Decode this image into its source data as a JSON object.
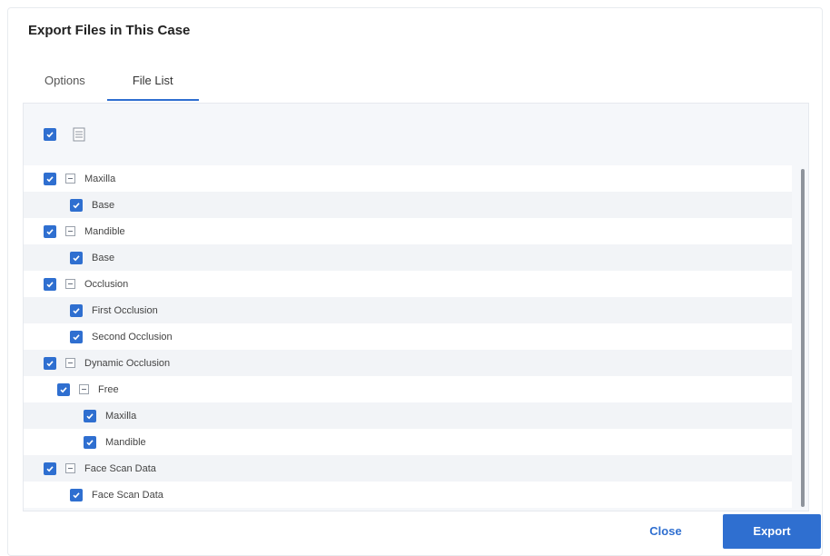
{
  "dialog": {
    "title": "Export Files in This Case",
    "tabs": [
      {
        "label": "Options",
        "active": false
      },
      {
        "label": "File List",
        "active": true
      }
    ],
    "select_all_checked": true,
    "tree": [
      {
        "label": "Maxilla",
        "level": 0,
        "collapsible": true,
        "checked": true
      },
      {
        "label": "Base",
        "level": 1,
        "collapsible": false,
        "checked": true
      },
      {
        "label": "Mandible",
        "level": 0,
        "collapsible": true,
        "checked": true
      },
      {
        "label": "Base",
        "level": 1,
        "collapsible": false,
        "checked": true
      },
      {
        "label": "Occlusion",
        "level": 0,
        "collapsible": true,
        "checked": true
      },
      {
        "label": "First Occlusion",
        "level": 1,
        "collapsible": false,
        "checked": true
      },
      {
        "label": "Second Occlusion",
        "level": 1,
        "collapsible": false,
        "checked": true
      },
      {
        "label": "Dynamic Occlusion",
        "level": 0,
        "collapsible": true,
        "checked": true
      },
      {
        "label": "Free",
        "level": 1,
        "collapsible": true,
        "checked": true
      },
      {
        "label": "Maxilla",
        "level": 2,
        "collapsible": false,
        "checked": true
      },
      {
        "label": "Mandible",
        "level": 2,
        "collapsible": false,
        "checked": true
      },
      {
        "label": "Face Scan Data",
        "level": 0,
        "collapsible": true,
        "checked": true
      },
      {
        "label": "Face Scan Data",
        "level": 1,
        "collapsible": false,
        "checked": true
      }
    ],
    "buttons": {
      "close_label": "Close",
      "export_label": "Export"
    },
    "colors": {
      "accent": "#2f6fd0"
    }
  }
}
